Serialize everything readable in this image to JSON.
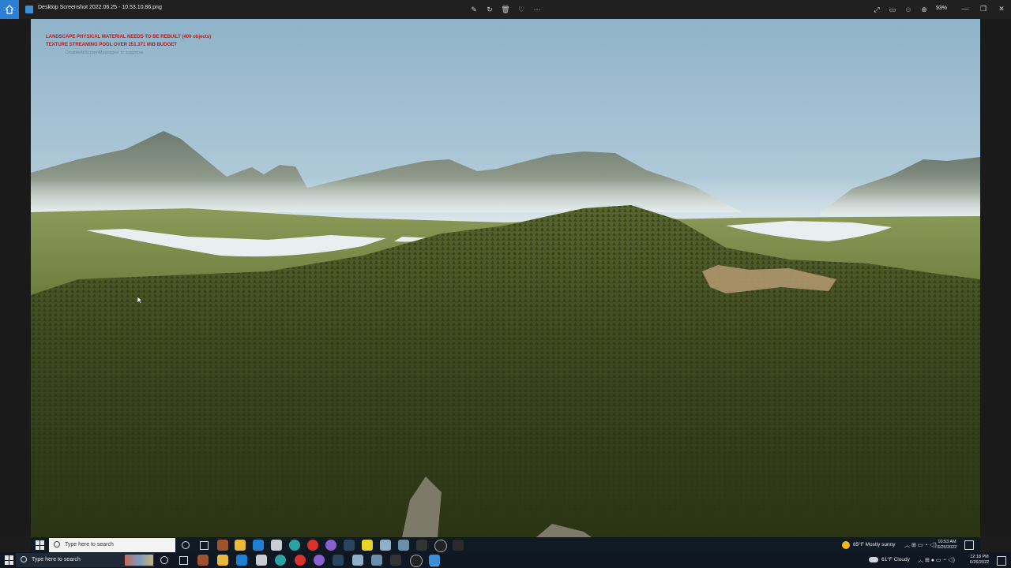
{
  "window": {
    "file_title": "Desktop Screenshot 2022.06.25 - 10.53.10.86.png",
    "zoom": "93%"
  },
  "toolbar": {
    "icons": [
      "edit-icon",
      "rotate-icon",
      "delete-icon",
      "favorite-icon",
      "more-icon"
    ],
    "right_icons": [
      "fullscreen-icon",
      "slideshow-icon",
      "zoom-out-icon",
      "zoom-in-icon"
    ]
  },
  "viewport": {
    "messages": [
      "LANDSCAPE PHYSICAL MATERIAL NEEDS TO BE REBUILT (400 objects)",
      "TEXTURE STREAMING POOL OVER 251.371 MiB BUDGET"
    ],
    "suppress_hint": "DisableAllScreenMessages' to suppress"
  },
  "inner_taskbar": {
    "search_placeholder": "Type here to search",
    "weather": "85°F  Mostly sunny",
    "time": "10:53 AM",
    "date": "6/25/2022"
  },
  "outer_taskbar": {
    "search_placeholder": "Type here to search",
    "weather": "61°F  Cloudy",
    "time": "12:18 PM",
    "date": "6/26/2022"
  },
  "colors": {
    "accent": "#2d7fd3",
    "warning_text": "#b51d1d",
    "sky_top": "#8fb3c9",
    "sky_horizon": "#dfe9ee",
    "forest": "#3f4a1e"
  }
}
